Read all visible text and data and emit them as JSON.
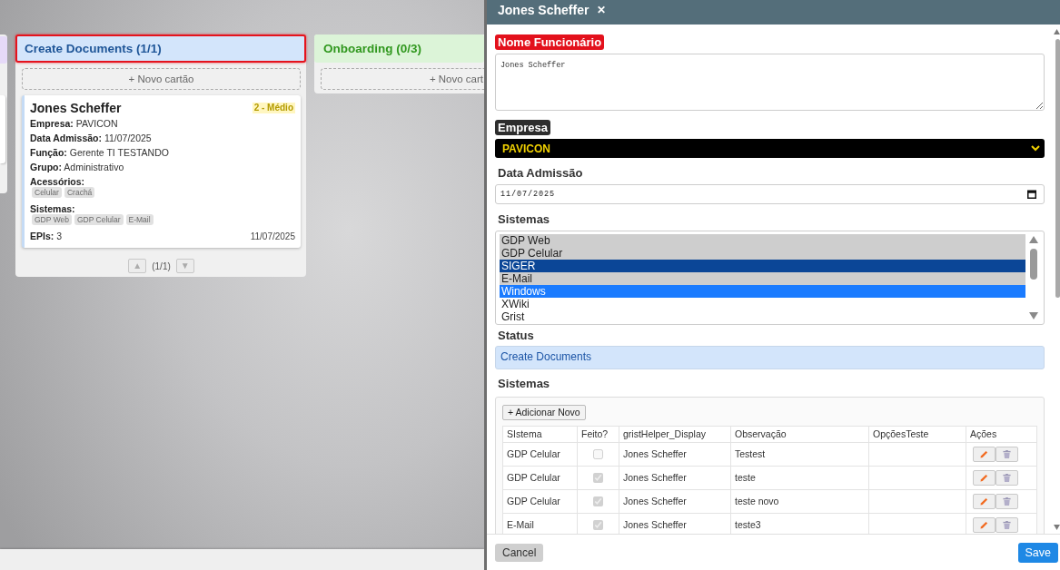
{
  "board": {
    "columns": [
      {
        "kind": "edge",
        "color": "#e6daf8",
        "selected": false
      },
      {
        "kind": "full",
        "title": "Create Documents (1/1)",
        "color": "#d3e5fb",
        "selected": true,
        "add_label": "+ Novo cartão",
        "cards": [
          {
            "title": "Jones Scheffer",
            "priority": "2 - Médio",
            "fields": [
              {
                "label": "Empresa:",
                "value": "PAVICON"
              },
              {
                "label": "Data Admissão:",
                "value": "11/07/2025"
              },
              {
                "label": "Função:",
                "value": "Gerente TI TESTANDO"
              },
              {
                "label": "Grupo:",
                "value": "Administrativo"
              }
            ],
            "tag_groups": [
              {
                "label": "Acessórios:",
                "tags": [
                  "Celular",
                  "Crachá"
                ]
              },
              {
                "label": "Sistemas:",
                "tags": [
                  "GDP Web",
                  "GDP Celular",
                  "E-Mail"
                ]
              }
            ],
            "epis": {
              "label": "EPIs:",
              "value": "3"
            },
            "date": "11/07/2025"
          }
        ],
        "pager": {
          "up": "▲",
          "label": "(1/1)",
          "down": "▼"
        }
      },
      {
        "kind": "full",
        "title": "Onboarding (0/3)",
        "color": "#dcf4d8",
        "selected": false,
        "add_label": "+ Novo cart"
      }
    ]
  },
  "drawer": {
    "title": "Jones Scheffer",
    "close": "✕",
    "fields": [
      {
        "kind": "textarea",
        "label": "Nome Funcionário",
        "color": "#e3111c",
        "value": "Jones Scheffer"
      },
      {
        "kind": "select",
        "label": "Empresa",
        "color": "#2d2d2d",
        "value": "PAVICON"
      },
      {
        "kind": "date",
        "label": "Data Admissão",
        "value": "11/07/2025"
      },
      {
        "kind": "listbox",
        "label": "Sistemas",
        "options": [
          {
            "label": "GDP Web",
            "selected": true,
            "active": false,
            "focused": false
          },
          {
            "label": "GDP Celular",
            "selected": true,
            "active": false,
            "focused": false
          },
          {
            "label": "SIGER",
            "selected": true,
            "active": true,
            "focused": false
          },
          {
            "label": "E-Mail",
            "selected": true,
            "active": false,
            "focused": false
          },
          {
            "label": "Windows",
            "selected": true,
            "active": false,
            "focused": true
          },
          {
            "label": "XWiki",
            "selected": false,
            "active": false,
            "focused": false
          },
          {
            "label": "Grist",
            "selected": false,
            "active": false,
            "focused": false
          }
        ]
      },
      {
        "kind": "status",
        "label": "Status",
        "value": "Create Documents"
      },
      {
        "kind": "subtable",
        "label": "Sistemas",
        "add_label": "+ Adicionar Novo",
        "columns": [
          "SIstema",
          "Feito?",
          "gristHelper_Display",
          "Observação",
          "OpçõesTeste",
          "Ações"
        ],
        "rows": [
          {
            "system": "GDP Celular",
            "checked": false,
            "disabled": true,
            "display": "Jones Scheffer",
            "note": "Testest"
          },
          {
            "system": "GDP Celular",
            "checked": true,
            "disabled": true,
            "display": "Jones Scheffer",
            "note": "teste"
          },
          {
            "system": "GDP Celular",
            "checked": true,
            "disabled": true,
            "display": "Jones Scheffer",
            "note": "teste novo"
          },
          {
            "system": "E-Mail",
            "checked": true,
            "disabled": true,
            "display": "Jones Scheffer",
            "note": "teste3"
          }
        ]
      }
    ],
    "cancel": "Cancel",
    "save": "Save"
  }
}
